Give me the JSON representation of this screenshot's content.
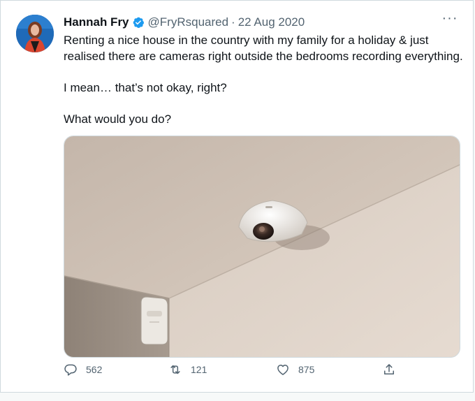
{
  "tweet": {
    "author_name": "Hannah Fry",
    "handle": "@FryRsquared",
    "separator": "·",
    "date": "22 Aug 2020",
    "more_label": "···",
    "paragraphs": [
      "Renting a nice house in the country  with my family for a holiday & just realised there are cameras right outside the bedrooms recording everything.",
      "I mean… that’s not okay, right?",
      "What would you do?"
    ]
  },
  "actions": {
    "reply_count": "562",
    "retweet_count": "121",
    "like_count": "875"
  },
  "icons": {
    "verified": "verified-badge-icon",
    "reply": "reply-icon",
    "retweet": "retweet-icon",
    "like": "heart-icon",
    "share": "share-icon"
  },
  "colors": {
    "verified": "#1d9bf0",
    "muted_text": "#536471",
    "text": "#0f1419"
  }
}
